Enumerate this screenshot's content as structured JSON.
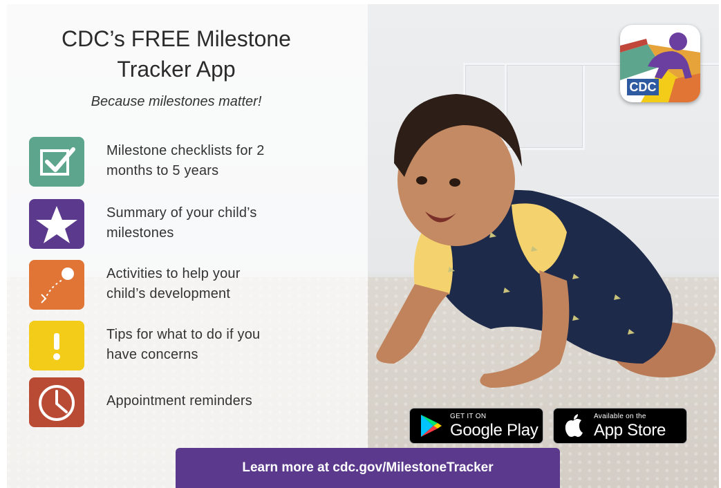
{
  "title_line1": "CDC’s FREE Milestone",
  "title_line2": "Tracker App",
  "tagline": "Because milestones matter!",
  "features": [
    {
      "line1": "Milestone checklists for 2",
      "line2": "months to 5 years",
      "icon": "checkbox-icon",
      "color": "#5ea58d"
    },
    {
      "line1": "Summary of your child’s",
      "line2": "milestones",
      "icon": "star-icon",
      "color": "#5b3a8e"
    },
    {
      "line1": "Activities to help your",
      "line2": "child’s development",
      "icon": "activity-icon",
      "color": "#e07535"
    },
    {
      "line1": "Tips for what to do if you",
      "line2": "have concerns",
      "icon": "exclamation-icon",
      "color": "#f2cc18"
    },
    {
      "line1": "Appointment reminders",
      "line2": "",
      "icon": "clock-icon",
      "color": "#b94a34"
    }
  ],
  "logo_text": "CDC",
  "google_play": {
    "small": "GET IT ON",
    "big": "Google Play"
  },
  "app_store": {
    "small": "Available on the",
    "big": "App Store"
  },
  "learn_more": "Learn more at cdc.gov/MilestoneTracker",
  "colors": {
    "purple": "#5b3a8e",
    "green": "#5ea58d",
    "orange": "#e07535",
    "yellow": "#f2cc18",
    "red": "#b94a34"
  }
}
